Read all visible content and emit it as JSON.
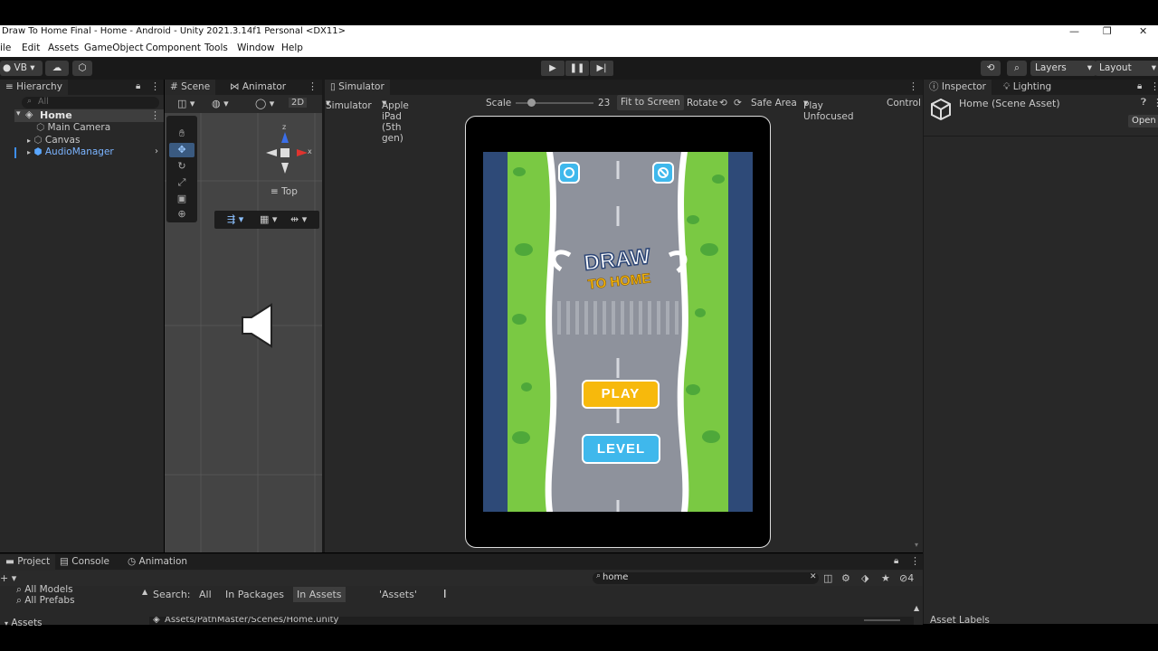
{
  "window": {
    "title": "Draw To Home Final - Home - Android - Unity 2021.3.14f1 Personal <DX11>",
    "minimize_glyph": "—",
    "maximize_glyph": "❐",
    "close_glyph": "✕"
  },
  "menu": [
    "ile",
    "Edit",
    "Assets",
    "GameObject",
    "Component",
    "Tools",
    "Window",
    "Help"
  ],
  "toolbar": {
    "account": "VB",
    "layers": "Layers",
    "layout": "Layout"
  },
  "hierarchy": {
    "tab": "Hierarchy",
    "search_placeholder": "All",
    "scene": "Home",
    "items": [
      "Main Camera",
      "Canvas",
      "AudioManager"
    ]
  },
  "scene_view": {
    "tabs": [
      "Scene",
      "Animator"
    ],
    "mode_2d": "2D",
    "gizmo_label": "Top",
    "axis_z": "z",
    "axis_x": "x"
  },
  "simulator": {
    "tab": "Simulator",
    "mode": "Simulator",
    "device": "Apple iPad (5th gen)",
    "scale_label": "Scale",
    "scale_value": "23",
    "scale_fraction": 0.2,
    "fit_label": "Fit to Screen",
    "rotate_label": "Rotate",
    "safe_area": "Safe Area",
    "play_mode": "Play Unfocused",
    "control": "Control"
  },
  "game": {
    "title_line1": "DRAW",
    "title_line2": "TO HOME",
    "play_button": "PLAY",
    "level_button": "LEVEL",
    "colors": {
      "grass": "#7ac943",
      "road": "#8e929c",
      "border": "#2e4a78",
      "play": "#f7b90c",
      "level": "#3fb8ec"
    }
  },
  "inspector": {
    "tabs": [
      "Inspector",
      "Lighting"
    ],
    "asset_title": "Home (Scene Asset)",
    "open_button": "Open",
    "asset_labels": "Asset Labels"
  },
  "project": {
    "tabs": [
      "Project",
      "Console",
      "Animation"
    ],
    "favorites": [
      "All Models",
      "All Prefabs"
    ],
    "assets_label": "Assets",
    "search_label": "Search:",
    "filters": [
      "All",
      "In Packages",
      "In Assets",
      "'Assets'"
    ],
    "search_value": "home",
    "badge_count": "4",
    "path": "Assets/PathMaster/Scenes/Home.unity"
  }
}
